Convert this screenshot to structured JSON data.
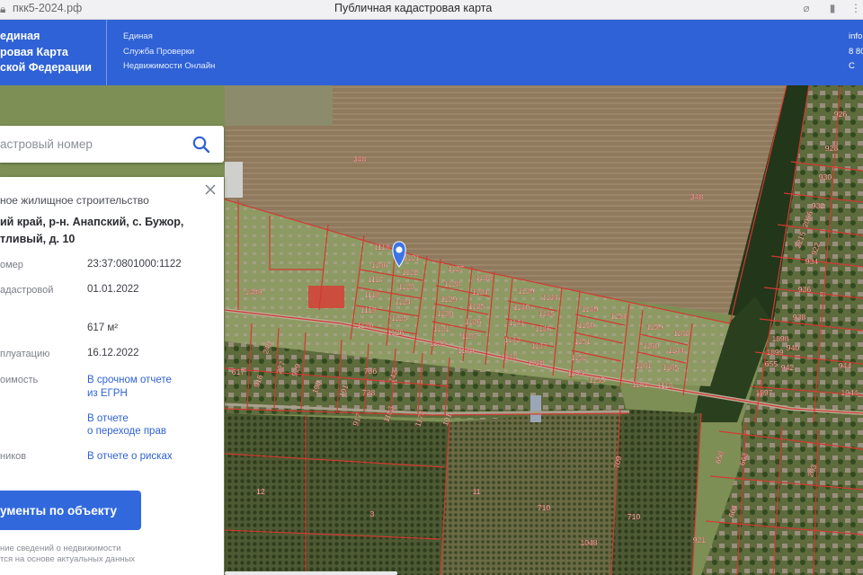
{
  "browser": {
    "url": "пкк5-2024.рф",
    "tab_title": "Публичная кадастровая карта",
    "icons": [
      "lock-icon",
      "tracking-off-icon",
      "bookmark-icon",
      "more-icon"
    ]
  },
  "header": {
    "brand_lines": [
      "единая",
      "ровая Карта",
      "ской Федерации"
    ],
    "service_lines": [
      "Единая",
      "Служба Проверки",
      "Недвижимости Онлайн"
    ],
    "contact_lines": [
      "info",
      "8 80",
      "С"
    ]
  },
  "search": {
    "placeholder": "астровый номер",
    "icon": "search-icon"
  },
  "panel": {
    "type": "ное жилищное строительство",
    "address_line1": "ий край, р-н. Анапский, с. Бужор,",
    "address_line2": "тливый, д. 10",
    "rows": [
      {
        "label": "омер",
        "value": "23:37:0801000:1122"
      },
      {
        "label": "адастровой",
        "value": "01.01.2022"
      },
      {
        "label": "",
        "value": "617 м²"
      },
      {
        "label": "плуатацию",
        "value": "16.12.2022"
      }
    ],
    "cost_label": "оимость",
    "cost_link_1": "В срочном отчете",
    "cost_link_2": "из ЕГРН",
    "transfer_link_1": "В отчете",
    "transfer_link_2": "о переходе прав",
    "owners_label": "ников",
    "risks_link": "В отчете о рисках",
    "docs_button": "ументы по объекту",
    "footnote_1": "ние сведений о недвижимости",
    "footnote_2": "тся на основе актуальных данных"
  },
  "map": {
    "parcel_labels": [
      "348",
      "348",
      "1480",
      "1118",
      "1121",
      "1166",
      "1122",
      "1117",
      "1123",
      "1118",
      "1124",
      "1119",
      "1125",
      "1120",
      "1126",
      "1127",
      "1128",
      "1129",
      "1130",
      "1131",
      "1132",
      "1133",
      "1134",
      "1135",
      "1136",
      "1137",
      "1138",
      "1139",
      "1140",
      "1141",
      "1142",
      "1143",
      "1144",
      "1145",
      "1146",
      "1147",
      "1148",
      "1149",
      "1150",
      "1151",
      "1152",
      "1153",
      "1154",
      "1155",
      "1159",
      "1160",
      "1161",
      "1162",
      "1163",
      "1164",
      "1165",
      "1116",
      "617",
      "240",
      "916",
      "227",
      "929",
      "190",
      "191",
      "738",
      "736",
      "742",
      "917",
      "1183",
      "1174",
      "101",
      "12",
      "3",
      "11",
      "710",
      "709",
      "710",
      "1048",
      "1897",
      "1898",
      "1899",
      "655",
      "658",
      "663",
      "664",
      "263",
      "921",
      "2006",
      "2215",
      "922",
      "926",
      "928",
      "930",
      "932",
      "934",
      "936",
      "938",
      "940",
      "942",
      "944",
      "1044",
      "1046"
    ],
    "colors": {
      "parcel_line": "#d23a32",
      "label_fill": "#ffffff",
      "marker": "#3d75e8"
    }
  }
}
